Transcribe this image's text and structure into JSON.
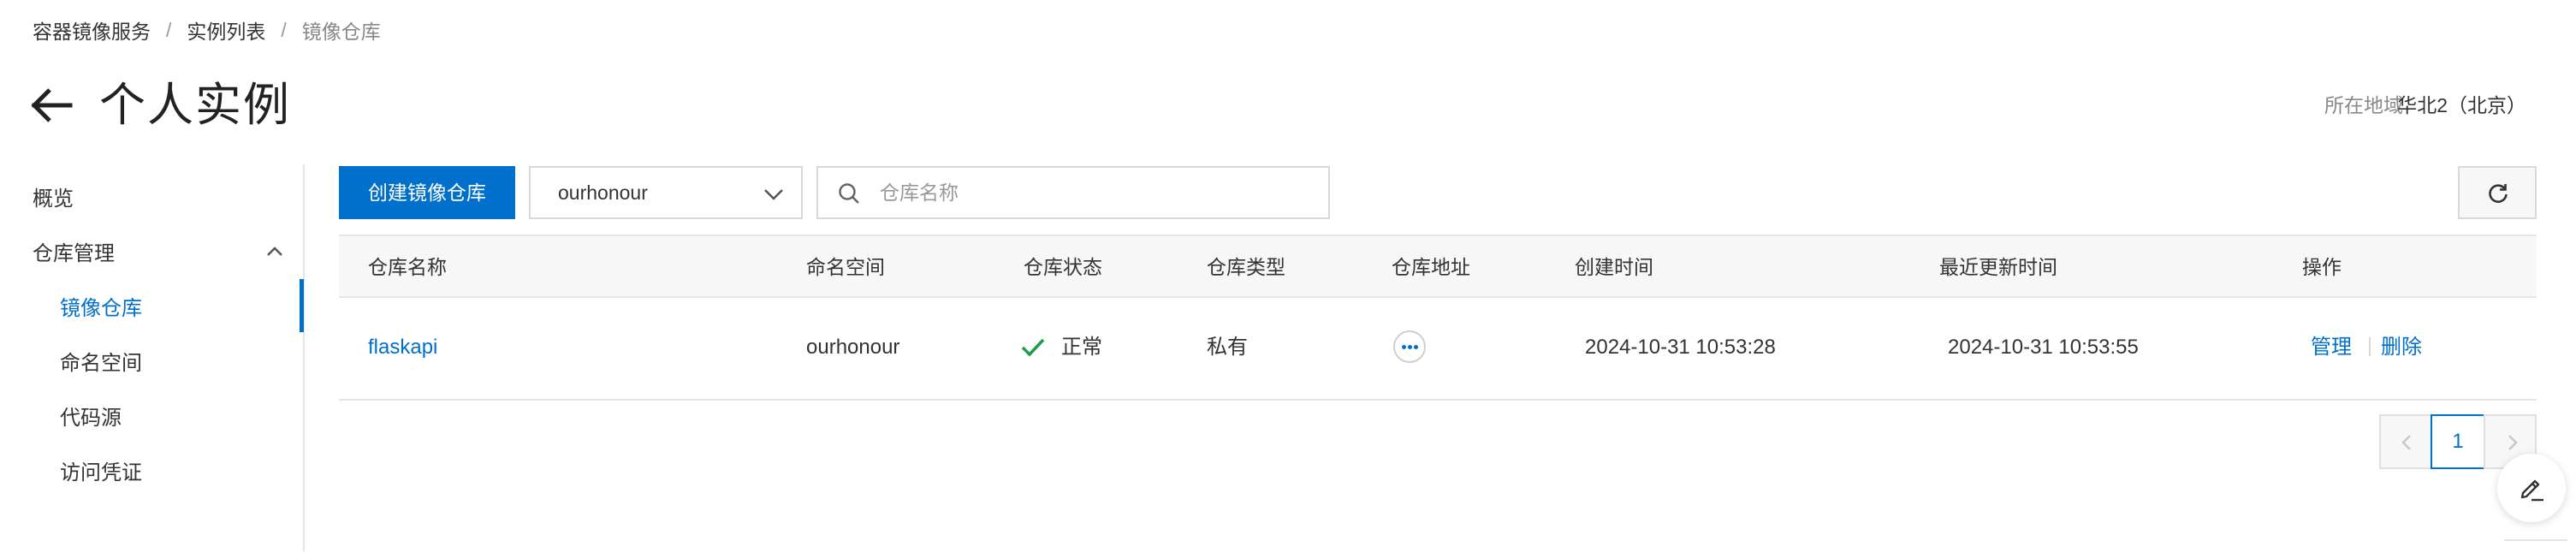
{
  "breadcrumb": {
    "item1": "容器镜像服务",
    "item2": "实例列表",
    "current": "镜像仓库",
    "separator": "/"
  },
  "header": {
    "back_icon": "arrow-left-icon",
    "title": "个人实例",
    "region_label": "所在地域",
    "region_value": "华北2（北京）"
  },
  "sidebar": {
    "overview": "概览",
    "repo_manage": "仓库管理",
    "items": [
      "镜像仓库",
      "命名空间",
      "代码源",
      "访问凭证"
    ],
    "active_index": 0
  },
  "toolbar": {
    "create_button": "创建镜像仓库",
    "namespace_selected": "ourhonour",
    "search_placeholder": "仓库名称",
    "refresh_icon": "refresh-icon"
  },
  "table": {
    "headers": [
      "仓库名称",
      "命名空间",
      "仓库状态",
      "仓库类型",
      "仓库地址",
      "创建时间",
      "最近更新时间",
      "操作"
    ],
    "rows": [
      {
        "name": "flaskapi",
        "namespace": "ourhonour",
        "status": "正常",
        "type": "私有",
        "address_icon": "more-icon",
        "created": "2024-10-31 10:53:28",
        "updated": "2024-10-31 10:53:55",
        "action_manage": "管理",
        "action_delete": "删除"
      }
    ]
  },
  "pagination": {
    "current": "1"
  },
  "colors": {
    "primary": "#0070cc",
    "success": "#1e9e4a",
    "border": "#e5e5e5",
    "header_bg": "#f7f7f7"
  }
}
